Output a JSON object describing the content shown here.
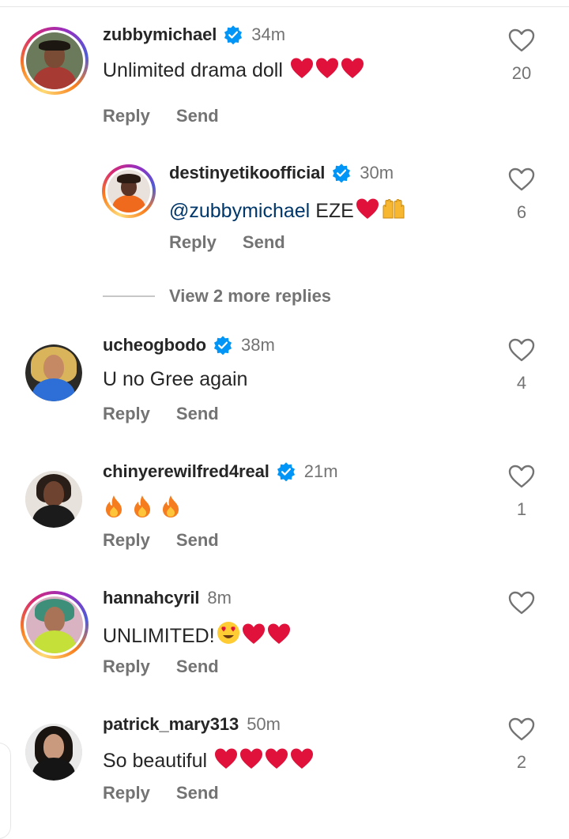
{
  "comments": [
    {
      "username": "zubbymichael",
      "verified": true,
      "time": "34m",
      "text": "Unlimited drama doll",
      "likes": "20",
      "reply": "Reply",
      "send": "Send"
    },
    {
      "username": "destinyetikoofficial",
      "verified": true,
      "time": "30m",
      "mention": "@zubbymichael",
      "text": "EZE",
      "likes": "6",
      "reply": "Reply",
      "send": "Send"
    },
    {
      "username": "ucheogbodo",
      "verified": true,
      "time": "38m",
      "text": "U no Gree again",
      "likes": "4",
      "reply": "Reply",
      "send": "Send"
    },
    {
      "username": "chinyerewilfred4real",
      "verified": true,
      "time": "21m",
      "text": "",
      "likes": "1",
      "reply": "Reply",
      "send": "Send"
    },
    {
      "username": "hannahcyril",
      "verified": false,
      "time": "8m",
      "text": "UNLIMITED!",
      "likes": "",
      "reply": "Reply",
      "send": "Send"
    },
    {
      "username": "patrick_mary313",
      "verified": false,
      "time": "50m",
      "text": "So beautiful",
      "likes": "2",
      "reply": "Reply",
      "send": "Send"
    }
  ],
  "view_more": "View 2 more replies",
  "colors": {
    "verified": "#0095f6",
    "heart": "#e0123b",
    "mention": "#00376b",
    "secondary": "#737373"
  },
  "icons": [
    "verified-badge-icon",
    "heart-outline-icon",
    "red-heart-emoji",
    "fire-emoji",
    "raised-hands-emoji",
    "heart-eyes-emoji"
  ]
}
